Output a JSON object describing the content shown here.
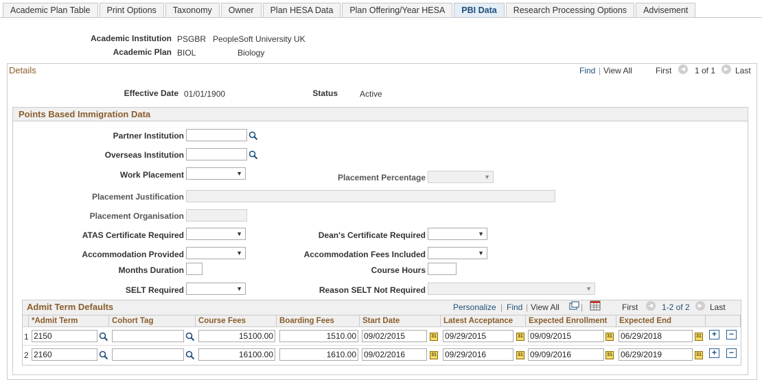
{
  "tabs": [
    "Academic Plan Table",
    "Print Options",
    "Taxonomy",
    "Owner",
    "Plan HESA Data",
    "Plan Offering/Year HESA",
    "PBI Data",
    "Research Processing Options",
    "Advisement"
  ],
  "active_tab": "PBI Data",
  "header": {
    "institution_label": "Academic Institution",
    "institution_code": "PSGBR",
    "institution_name": "PeopleSoft University UK",
    "plan_label": "Academic Plan",
    "plan_code": "BIOL",
    "plan_name": "Biology"
  },
  "details": {
    "title": "Details",
    "find": "Find",
    "view_all": "View All",
    "first": "First",
    "count": "1 of 1",
    "last": "Last",
    "effective_date_label": "Effective Date",
    "effective_date": "01/01/1900",
    "status_label": "Status",
    "status": "Active"
  },
  "pbi": {
    "title": "Points Based Immigration Data",
    "partner_institution": "Partner Institution",
    "overseas_institution": "Overseas Institution",
    "work_placement": "Work Placement",
    "placement_percentage": "Placement Percentage",
    "placement_justification": "Placement Justification",
    "placement_organisation": "Placement Organisation",
    "atas": "ATAS Certificate Required",
    "deans": "Dean's Certificate Required",
    "accommodation_provided": "Accommodation Provided",
    "accommodation_fees": "Accommodation Fees Included",
    "months_duration": "Months Duration",
    "course_hours": "Course Hours",
    "selt_required": "SELT Required",
    "reason_selt": "Reason SELT Not Required"
  },
  "grid": {
    "title": "Admit Term Defaults",
    "personalize": "Personalize",
    "find": "Find",
    "view_all": "View All",
    "first": "First",
    "count": "1-2 of 2",
    "last": "Last",
    "columns": [
      "*Admit Term",
      "Cohort Tag",
      "Course Fees",
      "Boarding Fees",
      "Start Date",
      "Latest Acceptance",
      "Expected Enrollment",
      "Expected End"
    ],
    "rows": [
      {
        "num": "1",
        "admit_term": "2150",
        "cohort_tag": "",
        "course_fees": "15100.00",
        "boarding_fees": "1510.00",
        "start_date": "09/02/2015",
        "latest_acceptance": "09/29/2015",
        "expected_enrollment": "09/09/2015",
        "expected_end": "06/29/2018"
      },
      {
        "num": "2",
        "admit_term": "2160",
        "cohort_tag": "",
        "course_fees": "16100.00",
        "boarding_fees": "1610.00",
        "start_date": "09/02/2016",
        "latest_acceptance": "09/29/2016",
        "expected_enrollment": "09/09/2016",
        "expected_end": "06/29/2019"
      }
    ]
  },
  "icons": {
    "lookup": "magnifier-icon",
    "calendar": "calendar-icon",
    "add": "plus-icon",
    "remove": "minus-icon",
    "prev": "chevron-left-icon",
    "next": "chevron-right-icon"
  }
}
